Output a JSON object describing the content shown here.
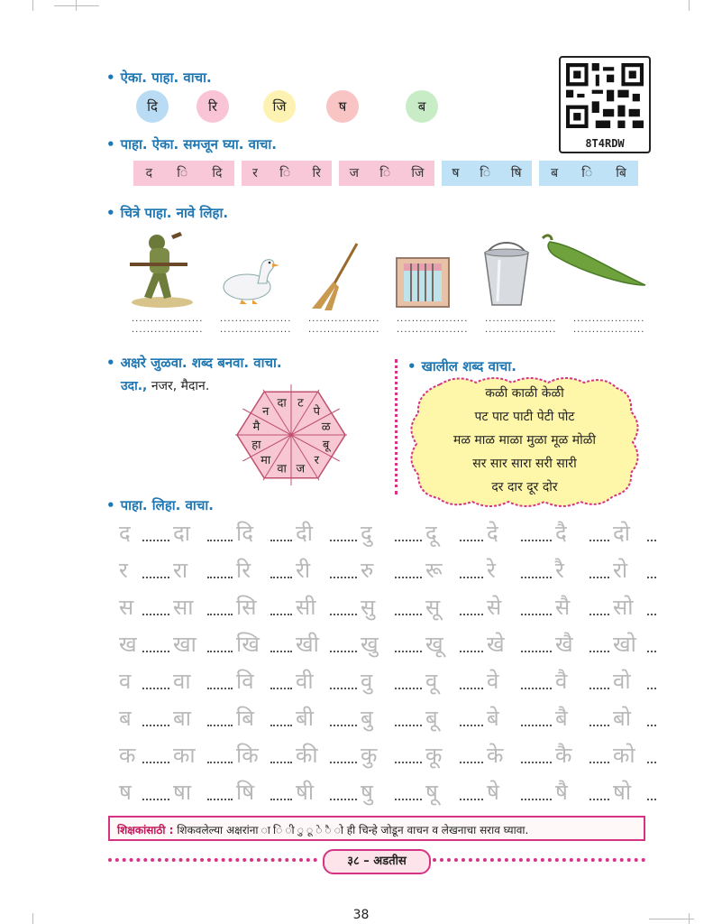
{
  "section1": {
    "heading": "ऐका. पाहा. वाचा.",
    "letters": [
      {
        "text": "दि",
        "color": "#b9dcf4"
      },
      {
        "text": "रि",
        "color": "#f8c4d6"
      },
      {
        "text": "जि",
        "color": "#fdf2b2"
      },
      {
        "text": "ष",
        "color": "#f8c4c4"
      },
      {
        "text": "ब",
        "color": "#c8ecc6"
      }
    ]
  },
  "qr": {
    "label": "8T4RDW"
  },
  "section2": {
    "heading": "पाहा. ऐका. समजून घ्या. वाचा.",
    "groups": [
      {
        "items": [
          "द",
          "ि",
          "दि"
        ],
        "color": "#f8c8d8"
      },
      {
        "items": [
          "र",
          "ि",
          "रि"
        ],
        "color": "#f8c8d8"
      },
      {
        "items": [
          "ज",
          "ि",
          "जि"
        ],
        "color": "#f8c8d8"
      },
      {
        "items": [
          "ष",
          "ि",
          "षि"
        ],
        "color": "#bfe2f7"
      },
      {
        "items": [
          "ब",
          "ि",
          "बि"
        ],
        "color": "#bfe2f7"
      }
    ]
  },
  "section3": {
    "heading": "चित्रे पाहा. नावे लिहा.",
    "pictures": [
      "soldier",
      "duck",
      "broom",
      "window",
      "bucket",
      "chilli"
    ],
    "dot_line": "..................."
  },
  "section4": {
    "heading": "अक्षरे जुळवा. शब्द बनवा. वाचा.",
    "example_label": "उदा.,",
    "example_words": "नजर, मैदान.",
    "hexagon_letters": [
      "दा",
      "ट",
      "पे",
      "ळ",
      "बू",
      "र",
      "ज",
      "वा",
      "मा",
      "हा",
      "मै",
      "न"
    ]
  },
  "section5": {
    "heading": "खालील शब्द वाचा.",
    "lines": [
      "कळी काळी केळी",
      "पट पाट पाटी पेटी पोट",
      "मळ माळ माळा मुळा मूळ मोळी",
      "सर सार सारा सरी सारी",
      "दर दार दूर दोर"
    ]
  },
  "section6": {
    "heading": "पाहा. लिहा. वाचा.",
    "rows": [
      [
        "द",
        "दा",
        "दि",
        "दी",
        "दु",
        "दू",
        "दे",
        "दै",
        "दो"
      ],
      [
        "र",
        "रा",
        "रि",
        "री",
        "रु",
        "रू",
        "रे",
        "रै",
        "रो"
      ],
      [
        "स",
        "सा",
        "सि",
        "सी",
        "सु",
        "सू",
        "से",
        "सै",
        "सो"
      ],
      [
        "ख",
        "खा",
        "खि",
        "खी",
        "खु",
        "खू",
        "खे",
        "खै",
        "खो"
      ],
      [
        "व",
        "वा",
        "वि",
        "वी",
        "वु",
        "वू",
        "वे",
        "वै",
        "वो"
      ],
      [
        "ब",
        "बा",
        "बि",
        "बी",
        "बु",
        "बू",
        "बे",
        "बै",
        "बो"
      ],
      [
        "क",
        "का",
        "कि",
        "की",
        "कु",
        "कू",
        "के",
        "कै",
        "को"
      ],
      [
        "ष",
        "षा",
        "षि",
        "षी",
        "षु",
        "षू",
        "षे",
        "षै",
        "षो"
      ]
    ]
  },
  "teacher_note": {
    "label": "शिक्षकांसाठी :",
    "text": " शिकवलेल्या अक्षरांना ा ि ी ु ू े ै ो ही चिन्हे जोडून वाचन व लेखनाचा सराव घ्यावा."
  },
  "footer": {
    "page_label": "३८ – अडतीस",
    "page_number": "38"
  },
  "colors": {
    "accent_blue": "#1f78b4",
    "accent_pink": "#d63384",
    "cloud_yellow": "#fef6a8"
  }
}
